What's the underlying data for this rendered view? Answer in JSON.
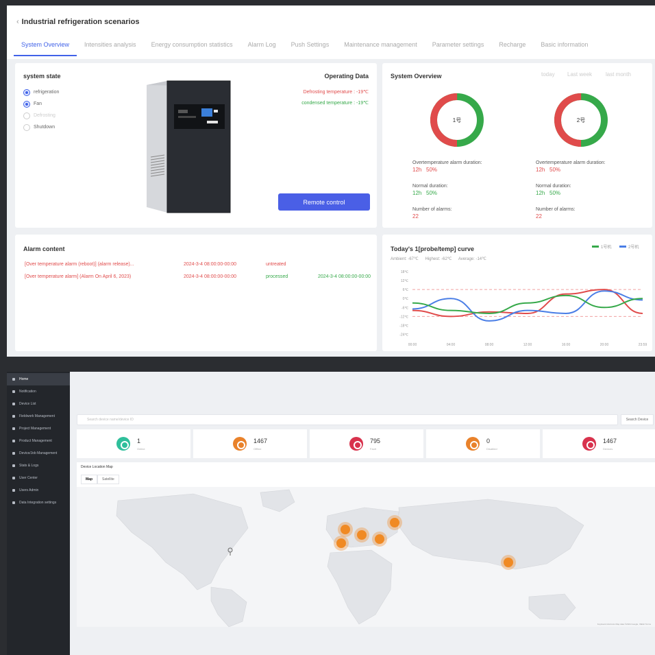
{
  "top": {
    "title": "Industrial refrigeration scenarios",
    "back_glyph": "‹",
    "tabs": [
      {
        "label": "System Overview",
        "active": true
      },
      {
        "label": "Intensities analysis",
        "active": false
      },
      {
        "label": "Energy consumption statistics",
        "active": false
      },
      {
        "label": "Alarm Log",
        "active": false
      },
      {
        "label": "Push Settings",
        "active": false
      },
      {
        "label": "Maintenance management",
        "active": false
      },
      {
        "label": "Parameter settings",
        "active": false
      },
      {
        "label": "Recharge",
        "active": false
      },
      {
        "label": "Basic information",
        "active": false
      }
    ],
    "system_state": {
      "title": "system state",
      "items": [
        {
          "label": "refrigeration",
          "state": "on"
        },
        {
          "label": "Fan",
          "state": "on"
        },
        {
          "label": "Defrosting",
          "state": "dim"
        },
        {
          "label": "Shutdown",
          "state": "off"
        }
      ]
    },
    "operating": {
      "title": "Operating Data",
      "line1": "Defrosting temperature : -19℃",
      "line2": "condensed temperature : -19℃"
    },
    "remote_btn": "Remote control",
    "overview": {
      "title": "System Overview",
      "periods": [
        {
          "label": "today",
          "active": true
        },
        {
          "label": "Last week",
          "active": false
        },
        {
          "label": "last month",
          "active": false
        }
      ],
      "units": [
        {
          "center": "1号",
          "ratio_red": 0.5,
          "overtemp_label": "Overtemperature alarm duration:",
          "overtemp_time": "12h",
          "overtemp_pct": "50%",
          "normal_label": "Normal duration:",
          "normal_time": "12h",
          "normal_pct": "50%",
          "alarms_label": "Number of alarms:",
          "alarms_val": "22"
        },
        {
          "center": "2号",
          "ratio_red": 0.5,
          "overtemp_label": "Overtemperature alarm duration:",
          "overtemp_time": "12h",
          "overtemp_pct": "50%",
          "normal_label": "Normal duration:",
          "normal_time": "12h",
          "normal_pct": "50%",
          "alarms_label": "Number of alarms:",
          "alarms_val": "22"
        }
      ]
    },
    "alarm": {
      "title": "Alarm content",
      "rows": [
        {
          "text": "[Over temperature alarm (reboot)] (alarm release)...",
          "time": "2024-3-4 08:00:00-00:00",
          "status": "untreated",
          "done": ""
        },
        {
          "text": "[Over temperature alarm] (Alarm On April 6, 2023)",
          "time": "2024-3-4 08:00:00-00:00",
          "status": "processed",
          "done": "2024-3-4 08:00:00-00:00"
        }
      ]
    },
    "curve": {
      "title": "Today's 1[probe/temp] curve",
      "legend": [
        {
          "name": "1号机",
          "color": "#36a94a"
        },
        {
          "name": "2号机",
          "color": "#4a7ee6"
        }
      ],
      "sub": [
        "Ambient: -67℃",
        "Highest: -62℃",
        "Average: -14℃"
      ]
    },
    "colors": {
      "accent": "#4062e8",
      "red": "#e04b4b",
      "green": "#36a94a",
      "blue": "#4a7ee6"
    }
  },
  "chart_data": {
    "type": "line",
    "x": [
      "00:00",
      "04:00",
      "08:00",
      "12:00",
      "16:00",
      "20:00",
      "23:59"
    ],
    "ylim": [
      -27,
      18
    ],
    "yticks": [
      "18℃",
      "12℃",
      "6℃",
      "0℃",
      "-6℃",
      "-12℃",
      "-18℃",
      "-24℃"
    ],
    "thresholds": [
      6,
      -12
    ],
    "series": [
      {
        "color": "#e04b4b",
        "values": [
          -8,
          -12,
          -9,
          -10,
          3,
          6,
          -10
        ]
      },
      {
        "color": "#4a7ee6",
        "values": [
          -7,
          0,
          -15,
          -8,
          -10,
          5,
          -1
        ]
      },
      {
        "color": "#36a94a",
        "values": [
          -3,
          -8,
          -10,
          -3,
          2,
          -6,
          0
        ]
      }
    ]
  },
  "bottom": {
    "sidebar": [
      {
        "label": "Home",
        "active": true
      },
      {
        "label": "Notification",
        "active": false
      },
      {
        "label": "Device List",
        "active": false
      },
      {
        "label": "Fieldwork Management",
        "active": false
      },
      {
        "label": "Project Management",
        "active": false
      },
      {
        "label": "Product Management",
        "active": false
      },
      {
        "label": "Device/Job Management",
        "active": false
      },
      {
        "label": "Stats & Logs",
        "active": false
      },
      {
        "label": "User Center",
        "active": false
      },
      {
        "label": "Users Admin",
        "active": false
      },
      {
        "label": "Data Integration settings",
        "active": false
      }
    ],
    "search_placeholder": "Search device name/device ID",
    "search_btn": "Search Device",
    "kpis": [
      {
        "value": "1",
        "label": "Online",
        "color": "#2fbf9b"
      },
      {
        "value": "1467",
        "label": "Offline",
        "color": "#e9822b"
      },
      {
        "value": "795",
        "label": "Fault",
        "color": "#d8324d"
      },
      {
        "value": "0",
        "label": "Disabled",
        "color": "#e9822b"
      },
      {
        "value": "1467",
        "label": "Devices",
        "color": "#d8324d"
      }
    ],
    "map_title": "Device Location Map",
    "map_tabs": [
      {
        "label": "Map",
        "active": true
      },
      {
        "label": "Satellite",
        "active": false
      }
    ],
    "map_attrib": "Keyboard shortcuts   Map data ©2024 Google, INEGI   Terms",
    "cluster_color": "#f08a24"
  }
}
